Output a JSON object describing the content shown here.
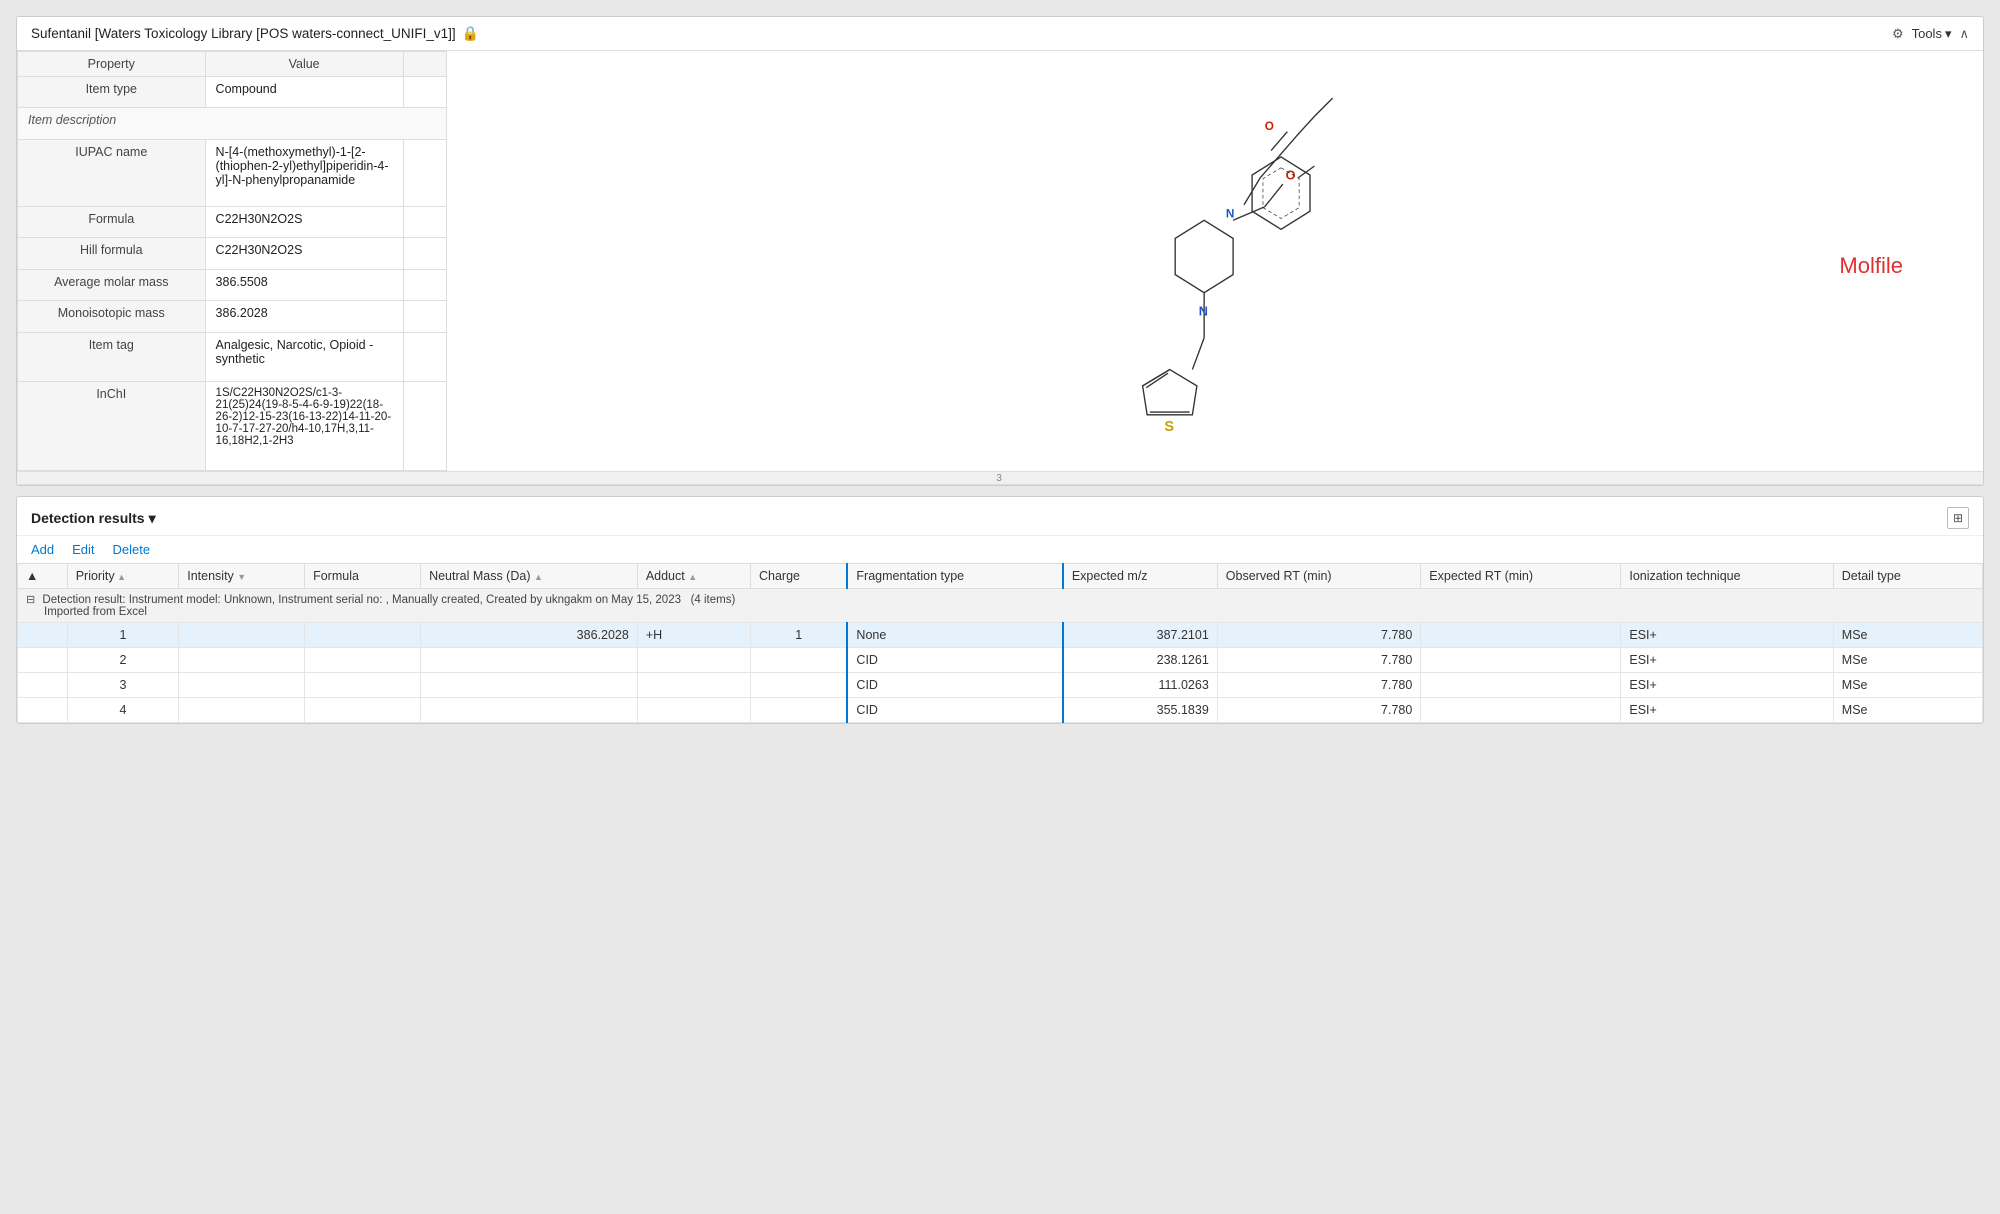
{
  "topPanel": {
    "title": "Sufentanil  [Waters Toxicology Library [POS waters-connect_UNIFI_v1]]",
    "shieldIcon": "🔒",
    "tools": {
      "label": "Tools",
      "icon": "⚙"
    },
    "collapseIcon": "^"
  },
  "propertiesTable": {
    "headers": [
      "Property",
      "Value",
      ""
    ],
    "sections": [
      {
        "type": "row",
        "property": "Item type",
        "value": "Compound"
      },
      {
        "type": "section",
        "label": "Item description"
      },
      {
        "type": "row",
        "property": "IUPAC name",
        "value": "N-[4-(methoxymethyl)-1-[2-(thiophen-2-yl)ethyl]piperidin-4-yl]-N-phenylpropanamide"
      },
      {
        "type": "row",
        "property": "Formula",
        "value": "C22H30N2O2S"
      },
      {
        "type": "row",
        "property": "Hill formula",
        "value": "C22H30N2O2S"
      },
      {
        "type": "row",
        "property": "Average molar mass",
        "value": "386.5508"
      },
      {
        "type": "row",
        "property": "Monoisotopic mass",
        "value": "386.2028"
      },
      {
        "type": "row",
        "property": "Item tag",
        "value": "Analgesic, Narcotic, Opioid - synthetic"
      },
      {
        "type": "row",
        "property": "InChI",
        "value": "1S/C22H30N2O2S/c1-3-21(25)24(19-8-5-4-6-9-19)22(18-26-2)12-15-23(16-13-22)14-11-20-10-7-17-27-20/h4-10,17H,3,11-16,18H2,1-2H3"
      }
    ]
  },
  "molfileLabel": "Molfile",
  "divider": "3",
  "bottomPanel": {
    "title": "Detection results",
    "gridIcon": "⊞",
    "toolbar": {
      "add": "Add",
      "edit": "Edit",
      "delete": "Delete"
    },
    "tableHeaders": {
      "priority": "Priority",
      "intensity": "Intensity",
      "formula": "Formula",
      "neutralMass": "Neutral Mass (Da)",
      "adduct": "Adduct",
      "charge": "Charge",
      "fragmentationType": "Fragmentation type",
      "expectedMz": "Expected m/z",
      "observedRt": "Observed RT (min)",
      "expectedRt": "Expected RT (min)",
      "ionizationTechnique": "Ionization technique",
      "detailType": "Detail type"
    },
    "groupHeader": "Detection result: Instrument model: Unknown, Instrument serial no: , Manually created, Created by ukngakm on May 15, 2023   (4 items)",
    "groupSubHeader": "Imported from Excel",
    "rows": [
      {
        "priority": "1",
        "intensity": "",
        "formula": "",
        "neutralMass": "386.2028",
        "adduct": "+H",
        "charge": "1",
        "fragmentationType": "None",
        "expectedMz": "387.2101",
        "observedRt": "7.780",
        "expectedRt": "",
        "ionizationTechnique": "ESI+",
        "detailType": "MSe",
        "selected": true
      },
      {
        "priority": "2",
        "intensity": "",
        "formula": "",
        "neutralMass": "",
        "adduct": "",
        "charge": "",
        "fragmentationType": "CID",
        "expectedMz": "238.1261",
        "observedRt": "7.780",
        "expectedRt": "",
        "ionizationTechnique": "ESI+",
        "detailType": "MSe",
        "selected": false
      },
      {
        "priority": "3",
        "intensity": "",
        "formula": "",
        "neutralMass": "",
        "adduct": "",
        "charge": "",
        "fragmentationType": "CID",
        "expectedMz": "111.0263",
        "observedRt": "7.780",
        "expectedRt": "",
        "ionizationTechnique": "ESI+",
        "detailType": "MSe",
        "selected": false
      },
      {
        "priority": "4",
        "intensity": "",
        "formula": "",
        "neutralMass": "",
        "adduct": "",
        "charge": "",
        "fragmentationType": "CID",
        "expectedMz": "355.1839",
        "observedRt": "7.780",
        "expectedRt": "",
        "ionizationTechnique": "ESI+",
        "detailType": "MSe",
        "selected": false
      }
    ]
  }
}
